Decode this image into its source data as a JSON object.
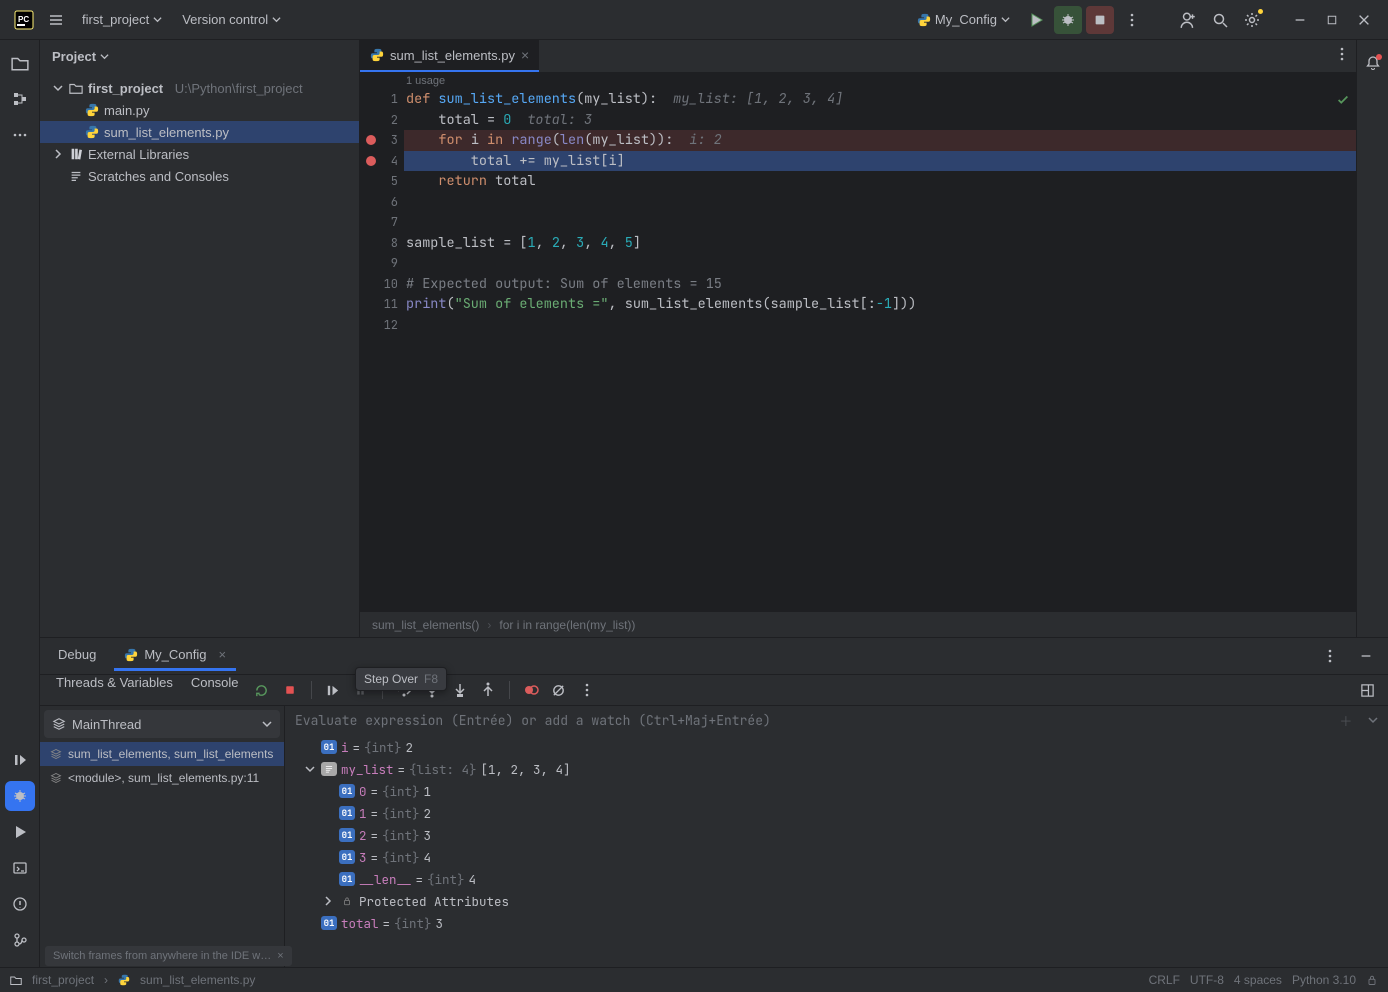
{
  "top": {
    "project": "first_project",
    "version_control": "Version control",
    "run_config": "My_Config"
  },
  "project": {
    "title": "Project",
    "root": {
      "name": "first_project",
      "path": "U:\\Python\\first_project"
    },
    "files": [
      "main.py",
      "sum_list_elements.py"
    ],
    "external": "External Libraries",
    "scratches": "Scratches and Consoles"
  },
  "tabs": {
    "file": "sum_list_elements.py",
    "usage": "1 usage"
  },
  "code": {
    "lines": [
      {
        "n": "1",
        "frag": [
          [
            "k",
            "def "
          ],
          [
            "fn",
            "sum_list_elements"
          ],
          [
            "",
            "(my_list):"
          ]
        ],
        "inlay": "my_list: [1, 2, 3, 4]"
      },
      {
        "n": "2",
        "frag": [
          [
            "",
            "    total = "
          ],
          [
            "n",
            "0"
          ]
        ],
        "inlay": "total: 3"
      },
      {
        "n": "3",
        "bp": true,
        "cls": "bp-line",
        "frag": [
          [
            "",
            "    "
          ],
          [
            "k",
            "for "
          ],
          [
            "",
            "i "
          ],
          [
            "k",
            "in "
          ],
          [
            "by",
            "range"
          ],
          [
            "",
            "("
          ],
          [
            "by",
            "len"
          ],
          [
            "",
            "(my_list)):"
          ]
        ],
        "inlay": "i: 2"
      },
      {
        "n": "4",
        "bp": true,
        "cls": "exec-line",
        "frag": [
          [
            "",
            "        total += my_list[i]"
          ]
        ]
      },
      {
        "n": "5",
        "frag": [
          [
            "",
            "    "
          ],
          [
            "k",
            "return "
          ],
          [
            "",
            "total"
          ]
        ]
      },
      {
        "n": "6",
        "frag": [
          [
            "",
            ""
          ]
        ]
      },
      {
        "n": "7",
        "frag": [
          [
            "",
            ""
          ]
        ]
      },
      {
        "n": "8",
        "frag": [
          [
            "",
            "sample_list = ["
          ],
          [
            "n",
            "1"
          ],
          [
            "",
            ", "
          ],
          [
            "n",
            "2"
          ],
          [
            "",
            ", "
          ],
          [
            "n",
            "3"
          ],
          [
            "",
            ", "
          ],
          [
            "n",
            "4"
          ],
          [
            "",
            ", "
          ],
          [
            "n",
            "5"
          ],
          [
            "",
            "]"
          ]
        ]
      },
      {
        "n": "9",
        "frag": [
          [
            "",
            ""
          ]
        ]
      },
      {
        "n": "10",
        "frag": [
          [
            "c",
            "# Expected output: Sum of elements = 15"
          ]
        ]
      },
      {
        "n": "11",
        "frag": [
          [
            "by",
            "print"
          ],
          [
            "",
            "("
          ],
          [
            "s",
            "\"Sum of elements =\""
          ],
          [
            "",
            ", sum_list_elements(sample_list[:"
          ],
          [
            "n",
            "-1"
          ],
          [
            "",
            "]))"
          ]
        ]
      },
      {
        "n": "12",
        "frag": [
          [
            "",
            ""
          ]
        ]
      }
    ]
  },
  "crumbs": [
    "sum_list_elements()",
    "for i in range(len(my_list))"
  ],
  "debug": {
    "label": "Debug",
    "config": "My_Config",
    "tabs": [
      "Threads & Variables",
      "Console"
    ],
    "thread": "MainThread",
    "frames": [
      "sum_list_elements, sum_list_elements",
      "<module>, sum_list_elements.py:11"
    ],
    "eval_placeholder": "Evaluate expression (Entrée) or add a watch (Ctrl+Maj+Entrée)",
    "tooltip": {
      "label": "Step Over",
      "key": "F8"
    },
    "vars": [
      {
        "ind": 0,
        "arrow": "",
        "ic": "01",
        "nm": "i",
        "ty": "{int}",
        "vv": "2"
      },
      {
        "ind": 0,
        "arrow": "v",
        "ic": "li",
        "nm": "my_list",
        "ty": "{list: 4}",
        "vv": "[1, 2, 3, 4]"
      },
      {
        "ind": 1,
        "arrow": "",
        "ic": "01",
        "nm": "0",
        "ty": "{int}",
        "vv": "1"
      },
      {
        "ind": 1,
        "arrow": "",
        "ic": "01",
        "nm": "1",
        "ty": "{int}",
        "vv": "2"
      },
      {
        "ind": 1,
        "arrow": "",
        "ic": "01",
        "nm": "2",
        "ty": "{int}",
        "vv": "3"
      },
      {
        "ind": 1,
        "arrow": "",
        "ic": "01",
        "nm": "3",
        "ty": "{int}",
        "vv": "4"
      },
      {
        "ind": 1,
        "arrow": "",
        "ic": "01",
        "nm": "__len__",
        "ty": "{int}",
        "vv": "4"
      },
      {
        "ind": 1,
        "arrow": ">",
        "ic": "pa",
        "nm": "Protected Attributes",
        "ty": "",
        "vv": ""
      },
      {
        "ind": 0,
        "arrow": "",
        "ic": "01",
        "nm": "total",
        "ty": "{int}",
        "vv": "3"
      }
    ],
    "frames_tip": "Switch frames from anywhere in the IDE w…"
  },
  "status": {
    "bc1": "first_project",
    "bc2": "sum_list_elements.py",
    "crlf": "CRLF",
    "enc": "UTF-8",
    "indent": "4 spaces",
    "python": "Python 3.10"
  }
}
